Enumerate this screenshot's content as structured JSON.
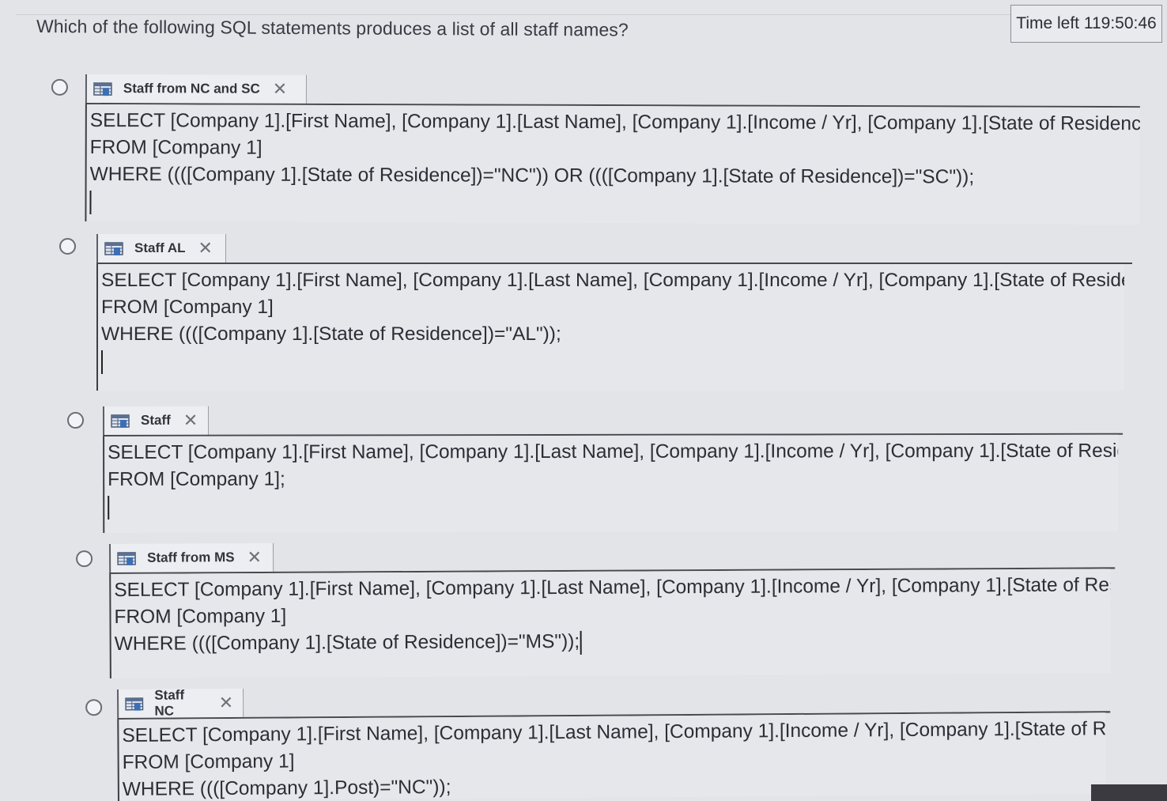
{
  "question": {
    "text": "Which of the following SQL statements produces a list of all staff names?"
  },
  "timer": {
    "text": "Time left 119:50:46"
  },
  "options": [
    {
      "tab_label": "Staff from NC and SC",
      "icon": "query-icon",
      "close_icon": "close-icon",
      "sql": [
        "SELECT [Company 1].[First Name], [Company 1].[Last Name], [Company 1].[Income / Yr], [Company 1].[State of Residence], [",
        "FROM [Company 1]",
        "WHERE ((([Company 1].[State of Residence])=\"NC\")) OR ((([Company 1].[State of Residence])=\"SC\"));"
      ]
    },
    {
      "tab_label": "Staff AL",
      "icon": "query-icon",
      "close_icon": "close-icon",
      "sql": [
        "SELECT [Company 1].[First Name], [Company 1].[Last Name], [Company 1].[Income / Yr], [Company 1].[State of Residence],",
        "FROM [Company 1]",
        "WHERE ((([Company 1].[State of Residence])=\"AL\"));"
      ]
    },
    {
      "tab_label": "Staff",
      "icon": "query-icon",
      "close_icon": "close-icon",
      "sql": [
        "SELECT [Company 1].[First Name], [Company 1].[Last Name], [Company 1].[Income / Yr], [Company 1].[State of Residence],",
        "FROM [Company 1];"
      ]
    },
    {
      "tab_label": "Staff from MS",
      "icon": "query-icon",
      "close_icon": "close-icon",
      "sql": [
        "SELECT [Company 1].[First Name], [Company 1].[Last Name], [Company 1].[Income / Yr], [Company 1].[State of Residence],",
        "FROM [Company 1]",
        "WHERE ((([Company 1].[State of Residence])=\"MS\"));"
      ]
    },
    {
      "tab_label": "Staff NC",
      "icon": "query-icon",
      "close_icon": "close-icon",
      "sql": [
        "SELECT [Company 1].[First Name], [Company 1].[Last Name], [Company 1].[Income / Yr], [Company 1].[State of Residence],",
        "FROM [Company 1]",
        "WHERE ((([Company 1].Post)=\"NC\"));"
      ]
    }
  ]
}
